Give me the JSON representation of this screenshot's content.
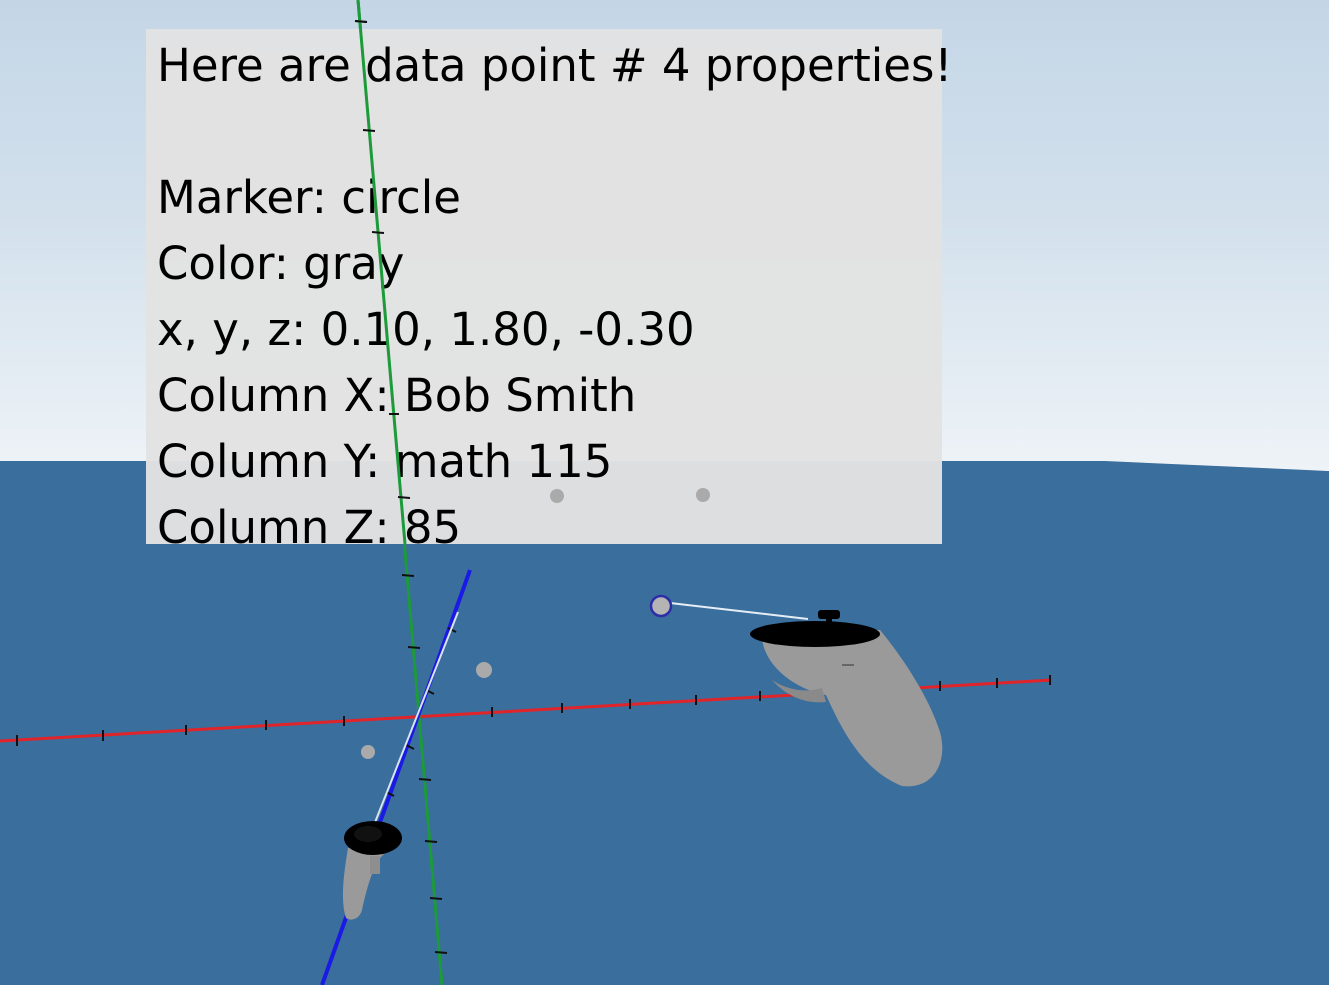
{
  "panel": {
    "title": "Here are data point # 4 properties!",
    "lines": [
      "Marker: circle",
      "Color: gray",
      "x, y, z: 0.10, 1.80, -0.30",
      "Column X: Bob Smith",
      "Column Y: math 115",
      "Column Z: 85"
    ]
  },
  "scene": {
    "sky_color": "#c8d9e7",
    "ground_color": "#3a6e9c",
    "x_axis_color": "#e0242a",
    "y_axis_color": "#1d9a3a",
    "z_axis_color": "#1a1ae6",
    "data_point_color": "#aaaaaa",
    "selected_point_color": "#2d2da8",
    "controllers": [
      "left-controller-icon",
      "right-controller-icon"
    ]
  }
}
